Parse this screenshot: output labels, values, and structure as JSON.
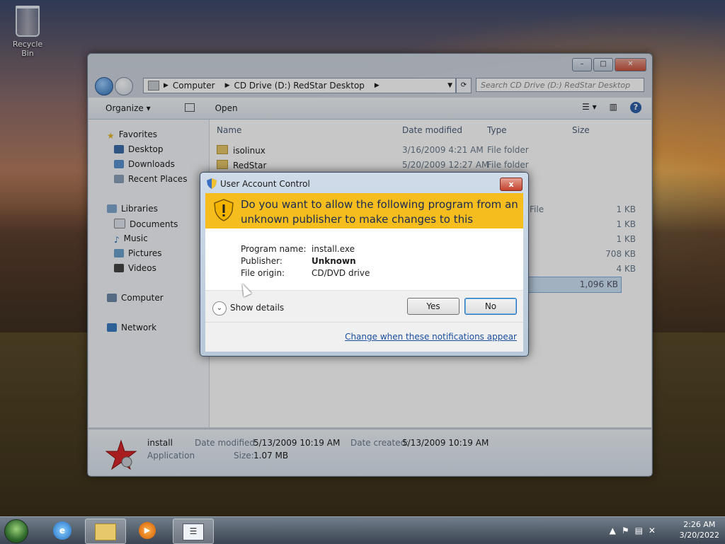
{
  "desktop": {
    "recycle_bin_label": "Recycle Bin"
  },
  "explorer": {
    "address": {
      "crumbs": [
        "Computer",
        "CD Drive (D:) RedStar Desktop"
      ],
      "search_placeholder": "Search CD Drive (D:) RedStar Desktop"
    },
    "toolbar": {
      "organize_label": "Organize ▾",
      "open_label": "Open"
    },
    "nav": {
      "favorites": "Favorites",
      "desktop": "Desktop",
      "downloads": "Downloads",
      "recent": "Recent Places",
      "libraries": "Libraries",
      "documents": "Documents",
      "music": "Music",
      "pictures": "Pictures",
      "videos": "Videos",
      "computer": "Computer",
      "network": "Network"
    },
    "columns": {
      "name": "Name",
      "date_modified": "Date modified",
      "type": "Type",
      "size": "Size"
    },
    "rows": [
      {
        "name": "isolinux",
        "date": "3/16/2009 4:21 AM",
        "type": "File folder",
        "size": ""
      },
      {
        "name": "RedStar",
        "date": "5/20/2009 12:27 AM",
        "type": "File folder",
        "size": ""
      },
      {
        "name": "",
        "date": "",
        "type": "File",
        "size": "1 KB"
      },
      {
        "name": "",
        "date": "",
        "type": "",
        "size": "1 KB"
      },
      {
        "name": "",
        "date": "",
        "type": "",
        "size": "1 KB"
      },
      {
        "name": "",
        "date": "",
        "type": "",
        "size": "708 KB"
      },
      {
        "name": "",
        "date": "",
        "type": "",
        "size": "4 KB"
      },
      {
        "name": "",
        "date": "",
        "type": "",
        "size": "1,096 KB"
      }
    ],
    "details": {
      "name": "install",
      "type": "Application",
      "date_modified_label": "Date modified:",
      "date_modified": "5/13/2009 10:19 AM",
      "date_created_label": "Date created:",
      "date_created": "5/13/2009 10:19 AM",
      "size_label": "Size:",
      "size": "1.07 MB"
    }
  },
  "uac": {
    "title": "User Account Control",
    "close_label": "x",
    "question": "Do you want to allow the following program from an unknown publisher to make changes to this computer?",
    "program_name_label": "Program name:",
    "program_name": "install.exe",
    "publisher_label": "Publisher:",
    "publisher": "Unknown",
    "file_origin_label": "File origin:",
    "file_origin": "CD/DVD drive",
    "show_details": "Show details",
    "yes_label": "Yes",
    "no_label": "No",
    "link_text": "Change when these notifications appear",
    "banner_color": "#f5bd1d"
  },
  "taskbar": {
    "time": "2:26 AM",
    "date": "3/20/2022"
  }
}
